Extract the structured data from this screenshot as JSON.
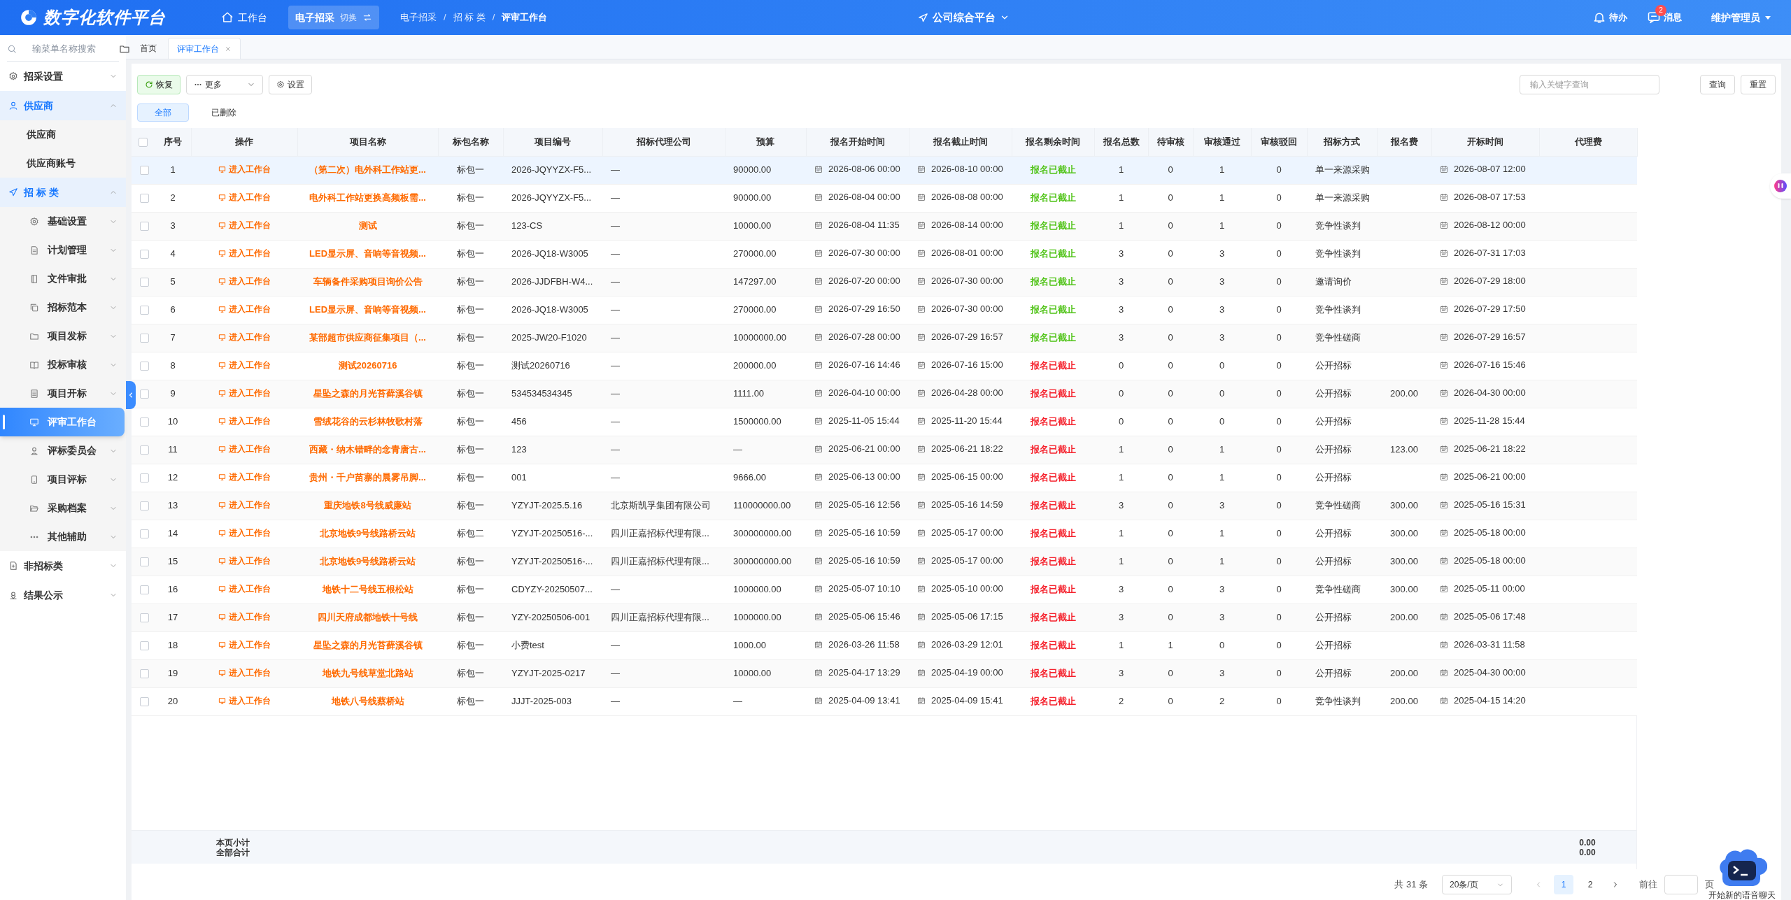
{
  "header": {
    "logo": "数字化软件平台",
    "home": "工作台",
    "system": {
      "label": "电子招采",
      "switch": "切换",
      "active": true
    },
    "breadcrumb": [
      "电子招采",
      "招 标 类",
      "评审工作台"
    ],
    "breadcrumb_separator": "/",
    "platform": "公司综合平台",
    "todo": "待办",
    "messages": {
      "label": "消息",
      "badge": "2"
    },
    "user": "维护管理员"
  },
  "sidebar": {
    "search": {
      "placeholder": "输菜单名称搜索"
    },
    "items": [
      {
        "label": "招采设置",
        "expanded": false
      },
      {
        "label": "供应商",
        "expanded": true,
        "children": [
          {
            "label": "供应商",
            "selected": false
          },
          {
            "label": "供应商账号",
            "selected": false
          }
        ]
      },
      {
        "label": "招 标 类",
        "expanded": true,
        "children": [
          {
            "label": "基础设置",
            "expanded": false
          },
          {
            "label": "计划管理",
            "expanded": false
          },
          {
            "label": "文件审批",
            "expanded": false
          },
          {
            "label": "招标范本",
            "expanded": false
          },
          {
            "label": "项目发标",
            "expanded": false
          },
          {
            "label": "投标审核",
            "expanded": false
          },
          {
            "label": "项目开标",
            "expanded": false
          },
          {
            "label": "评审工作台",
            "selected": true
          },
          {
            "label": "评标委员会",
            "expanded": false
          },
          {
            "label": "项目评标",
            "expanded": false
          },
          {
            "label": "采购档案",
            "expanded": false
          },
          {
            "label": "其他辅助",
            "expanded": false
          }
        ]
      },
      {
        "label": "非招标类",
        "expanded": false
      },
      {
        "label": "结果公示",
        "expanded": false
      }
    ]
  },
  "tabs": [
    {
      "label": "首页",
      "selected": false,
      "closable": false
    },
    {
      "label": "评审工作台",
      "selected": true,
      "closable": true
    }
  ],
  "toolbar": {
    "buttons": [
      {
        "kind": "restore",
        "label": "恢复"
      },
      {
        "kind": "more",
        "label": "更多"
      },
      {
        "kind": "settings",
        "label": "设置"
      }
    ],
    "search": {
      "placeholder": "输入关键字查询"
    },
    "actions": [
      "查询",
      "重置"
    ]
  },
  "filters": [
    {
      "label": "全部",
      "selected": true
    },
    {
      "label": "已删除",
      "selected": false
    }
  ],
  "table": {
    "select_all_checked": false,
    "columns": [
      "序号",
      "操作",
      "项目名称",
      "标包名称",
      "项目编号",
      "招标代理公司",
      "预算",
      "报名开始时间",
      "报名截止时间",
      "报名剩余时间",
      "报名总数",
      "待审核",
      "审核通过",
      "审核驳回",
      "招标方式",
      "报名费",
      "开标时间",
      "代理费"
    ],
    "rows": [
      {
        "highlighted": true,
        "checked": false,
        "no": "1",
        "action": "进入工作台",
        "name": "（第二次）电外科工作站更...",
        "package": "标包一",
        "code": "2026-JQYYZX-F5...",
        "agency": "—",
        "budget": "90000.00",
        "start": "2026-08-06 00:00",
        "end": "2026-08-10 00:00",
        "remaining": "报名已截止",
        "color": "#52c41a",
        "total": "1",
        "pending": "0",
        "passed": "1",
        "rejected": "0",
        "method": "单一来源采购",
        "open_time": "2026-08-07 12:00"
      },
      {
        "highlighted": false,
        "checked": false,
        "no": "2",
        "action": "进入工作台",
        "name": "电外科工作站更换高频板需...",
        "package": "标包一",
        "code": "2026-JQYYZX-F5...",
        "agency": "—",
        "budget": "90000.00",
        "start": "2026-08-04 00:00",
        "end": "2026-08-08 00:00",
        "remaining": "报名已截止",
        "color": "#52c41a",
        "total": "1",
        "pending": "0",
        "passed": "1",
        "rejected": "0",
        "method": "单一来源采购",
        "open_time": "2026-08-07 17:53"
      },
      {
        "highlighted": false,
        "checked": false,
        "no": "3",
        "action": "进入工作台",
        "name": "测试",
        "package": "标包一",
        "code": "123-CS",
        "agency": "—",
        "budget": "10000.00",
        "start": "2026-08-04 11:35",
        "end": "2026-08-14 00:00",
        "remaining": "报名已截止",
        "color": "#52c41a",
        "total": "1",
        "pending": "0",
        "passed": "1",
        "rejected": "0",
        "method": "竞争性谈判",
        "open_time": "2026-08-12 00:00"
      },
      {
        "highlighted": false,
        "checked": false,
        "no": "4",
        "action": "进入工作台",
        "name": "LED显示屏、音响等音视频...",
        "package": "标包一",
        "code": "2026-JQ18-W3005",
        "agency": "—",
        "budget": "270000.00",
        "start": "2026-07-30 00:00",
        "end": "2026-08-01 00:00",
        "remaining": "报名已截止",
        "color": "#52c41a",
        "total": "3",
        "pending": "0",
        "passed": "3",
        "rejected": "0",
        "method": "竞争性谈判",
        "open_time": "2026-07-31 17:03"
      },
      {
        "highlighted": false,
        "checked": false,
        "no": "5",
        "action": "进入工作台",
        "name": "车辆备件采购项目询价公告",
        "package": "标包一",
        "code": "2026-JJDFBH-W4...",
        "agency": "—",
        "budget": "147297.00",
        "start": "2026-07-20 00:00",
        "end": "2026-07-30 00:00",
        "remaining": "报名已截止",
        "color": "#52c41a",
        "total": "3",
        "pending": "0",
        "passed": "3",
        "rejected": "0",
        "method": "邀请询价",
        "open_time": "2026-07-29 18:00"
      },
      {
        "highlighted": false,
        "checked": false,
        "no": "6",
        "action": "进入工作台",
        "name": "LED显示屏、音响等音视频...",
        "package": "标包一",
        "code": "2026-JQ18-W3005",
        "agency": "—",
        "budget": "270000.00",
        "start": "2026-07-29 16:50",
        "end": "2026-07-30 00:00",
        "remaining": "报名已截止",
        "color": "#52c41a",
        "total": "3",
        "pending": "0",
        "passed": "3",
        "rejected": "0",
        "method": "竞争性谈判",
        "open_time": "2026-07-29 17:50"
      },
      {
        "highlighted": false,
        "checked": false,
        "no": "7",
        "action": "进入工作台",
        "name": "某部超市供应商征集项目（...",
        "package": "标包一",
        "code": "2025-JW20-F1020",
        "agency": "—",
        "budget": "10000000.00",
        "start": "2026-07-28 00:00",
        "end": "2026-07-29 16:57",
        "remaining": "报名已截止",
        "color": "#52c41a",
        "total": "3",
        "pending": "0",
        "passed": "3",
        "rejected": "0",
        "method": "竞争性磋商",
        "open_time": "2026-07-29 16:57"
      },
      {
        "highlighted": false,
        "checked": false,
        "no": "8",
        "action": "进入工作台",
        "name": "测试20260716",
        "package": "标包一",
        "code": "测试20260716",
        "agency": "—",
        "budget": "200000.00",
        "start": "2026-07-16 14:46",
        "end": "2026-07-16 15:00",
        "remaining": "报名已截止",
        "color": "#f5222d",
        "total": "0",
        "pending": "0",
        "passed": "0",
        "rejected": "0",
        "method": "公开招标",
        "open_time": "2026-07-16 15:46"
      },
      {
        "highlighted": false,
        "checked": false,
        "no": "9",
        "action": "进入工作台",
        "name": "星坠之森的月光苔藓溪谷镇",
        "package": "标包一",
        "code": "534534534345",
        "agency": "—",
        "budget": "1111.00",
        "start": "2026-04-10 00:00",
        "end": "2026-04-28 00:00",
        "remaining": "报名已截止",
        "color": "#f5222d",
        "total": "0",
        "pending": "0",
        "passed": "0",
        "rejected": "0",
        "method": "公开招标",
        "fee": "200.00",
        "open_time": "2026-04-30 00:00"
      },
      {
        "highlighted": false,
        "checked": false,
        "no": "10",
        "action": "进入工作台",
        "name": "雪绒花谷的云杉林牧歌村落",
        "package": "标包一",
        "code": "456",
        "agency": "—",
        "budget": "1500000.00",
        "start": "2025-11-05 15:44",
        "end": "2025-11-20 15:44",
        "remaining": "报名已截止",
        "color": "#f5222d",
        "total": "0",
        "pending": "0",
        "passed": "0",
        "rejected": "0",
        "method": "公开招标",
        "open_time": "2025-11-28 15:44"
      },
      {
        "highlighted": false,
        "checked": false,
        "no": "11",
        "action": "进入工作台",
        "name": "西藏・纳木错畔的念青唐古...",
        "package": "标包一",
        "code": "123",
        "agency": "—",
        "budget": "—",
        "start": "2025-06-21 00:00",
        "end": "2025-06-21 18:22",
        "remaining": "报名已截止",
        "color": "#f5222d",
        "total": "1",
        "pending": "0",
        "passed": "1",
        "rejected": "0",
        "method": "公开招标",
        "fee": "123.00",
        "open_time": "2025-06-21 18:22"
      },
      {
        "highlighted": false,
        "checked": false,
        "no": "12",
        "action": "进入工作台",
        "name": "贵州・千户苗寨的晨雾吊脚...",
        "package": "标包一",
        "code": "001",
        "agency": "—",
        "budget": "9666.00",
        "start": "2025-06-13 00:00",
        "end": "2025-06-15 00:00",
        "remaining": "报名已截止",
        "color": "#f5222d",
        "total": "1",
        "pending": "0",
        "passed": "1",
        "rejected": "0",
        "method": "公开招标",
        "open_time": "2025-06-21 00:00"
      },
      {
        "highlighted": false,
        "checked": false,
        "no": "13",
        "action": "进入工作台",
        "name": "重庆地铁8号线威廉站",
        "package": "标包一",
        "code": "YZYJT-2025.5.16",
        "agency": "北京斯凯孚集团有限公司",
        "budget": "110000000.00",
        "start": "2025-05-16 12:56",
        "end": "2025-05-16 14:59",
        "remaining": "报名已截止",
        "color": "#f5222d",
        "total": "3",
        "pending": "0",
        "passed": "3",
        "rejected": "0",
        "method": "竞争性磋商",
        "fee": "300.00",
        "open_time": "2025-05-16 15:31"
      },
      {
        "highlighted": false,
        "checked": false,
        "no": "14",
        "action": "进入工作台",
        "name": "北京地铁9号线路桥云站",
        "package": "标包二",
        "code": "YZYJT-20250516-...",
        "agency": "四川正嘉招标代理有限...",
        "budget": "300000000.00",
        "start": "2025-05-16 10:59",
        "end": "2025-05-17 00:00",
        "remaining": "报名已截止",
        "color": "#f5222d",
        "total": "1",
        "pending": "0",
        "passed": "1",
        "rejected": "0",
        "method": "公开招标",
        "fee": "300.00",
        "open_time": "2025-05-18 00:00"
      },
      {
        "highlighted": false,
        "checked": false,
        "no": "15",
        "action": "进入工作台",
        "name": "北京地铁9号线路桥云站",
        "package": "标包一",
        "code": "YZYJT-20250516-...",
        "agency": "四川正嘉招标代理有限...",
        "budget": "300000000.00",
        "start": "2025-05-16 10:59",
        "end": "2025-05-17 00:00",
        "remaining": "报名已截止",
        "color": "#f5222d",
        "total": "1",
        "pending": "0",
        "passed": "1",
        "rejected": "0",
        "method": "公开招标",
        "fee": "300.00",
        "open_time": "2025-05-18 00:00"
      },
      {
        "highlighted": false,
        "checked": false,
        "no": "16",
        "action": "进入工作台",
        "name": "地铁十二号线五根松站",
        "package": "标包一",
        "code": "CDYZY-20250507...",
        "agency": "—",
        "budget": "1000000.00",
        "start": "2025-05-07 10:10",
        "end": "2025-05-10 00:00",
        "remaining": "报名已截止",
        "color": "#f5222d",
        "total": "3",
        "pending": "0",
        "passed": "3",
        "rejected": "0",
        "method": "竞争性磋商",
        "fee": "300.00",
        "open_time": "2025-05-11 00:00"
      },
      {
        "highlighted": false,
        "checked": false,
        "no": "17",
        "action": "进入工作台",
        "name": "四川天府成都地铁十号线",
        "package": "标包一",
        "code": "YZY-20250506-001",
        "agency": "四川正嘉招标代理有限...",
        "budget": "1000000.00",
        "start": "2025-05-06 15:46",
        "end": "2025-05-06 17:15",
        "remaining": "报名已截止",
        "color": "#f5222d",
        "total": "3",
        "pending": "0",
        "passed": "3",
        "rejected": "0",
        "method": "公开招标",
        "fee": "200.00",
        "open_time": "2025-05-06 17:48"
      },
      {
        "highlighted": false,
        "checked": false,
        "no": "18",
        "action": "进入工作台",
        "name": "星坠之森的月光苔藓溪谷镇",
        "package": "标包一",
        "code": "小费test",
        "agency": "—",
        "budget": "1000.00",
        "start": "2026-03-26 11:58",
        "end": "2026-03-29 12:01",
        "remaining": "报名已截止",
        "color": "#f5222d",
        "total": "1",
        "pending": "1",
        "passed": "0",
        "rejected": "0",
        "method": "公开招标",
        "open_time": "2026-03-31 11:58"
      },
      {
        "highlighted": false,
        "checked": false,
        "no": "19",
        "action": "进入工作台",
        "name": "地铁九号线草堂北路站",
        "package": "标包一",
        "code": "YZYJT-2025-0217",
        "agency": "—",
        "budget": "10000.00",
        "start": "2025-04-17 13:29",
        "end": "2025-04-19 00:00",
        "remaining": "报名已截止",
        "color": "#f5222d",
        "total": "3",
        "pending": "0",
        "passed": "3",
        "rejected": "0",
        "method": "公开招标",
        "fee": "200.00",
        "open_time": "2025-04-30 00:00"
      },
      {
        "highlighted": false,
        "checked": false,
        "no": "20",
        "action": "进入工作台",
        "name": "地铁八号线蔡桥站",
        "package": "标包一",
        "code": "JJJT-2025-003",
        "agency": "—",
        "budget": "—",
        "start": "2025-04-09 13:41",
        "end": "2025-04-09 15:41",
        "remaining": "报名已截止",
        "color": "#f5222d",
        "total": "2",
        "pending": "0",
        "passed": "2",
        "rejected": "0",
        "method": "竞争性谈判",
        "fee": "200.00",
        "open_time": "2025-04-15 14:20"
      }
    ],
    "summary": {
      "labels": [
        "本页小计",
        "全部合计"
      ],
      "agency_fee": [
        "0.00",
        "0.00"
      ]
    }
  },
  "pagination": {
    "total": "共 31 条",
    "page_size": "20条/页",
    "pages": [
      {
        "label": "1",
        "selected": true
      },
      {
        "label": "2",
        "selected": false
      }
    ],
    "goto": "前往",
    "goto_suffix": "页"
  },
  "assistant": {
    "caption": "开始新的语音聊天"
  }
}
